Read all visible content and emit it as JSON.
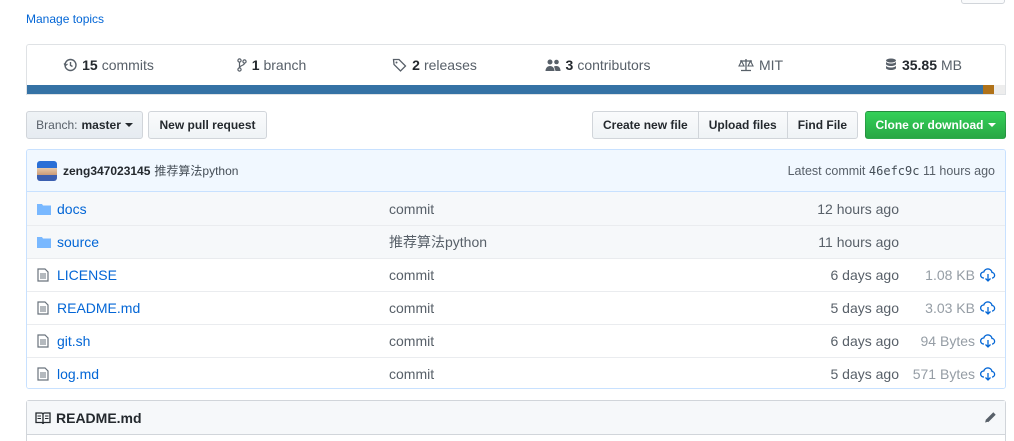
{
  "topics": {
    "manage_label": "Manage topics"
  },
  "summary": {
    "commits": {
      "count": "15",
      "label": "commits",
      "icon": "history-icon"
    },
    "branches": {
      "count": "1",
      "label": "branch",
      "icon": "branch-icon"
    },
    "releases": {
      "count": "2",
      "label": "releases",
      "icon": "tag-icon"
    },
    "contributors": {
      "count": "3",
      "label": "contributors",
      "icon": "people-icon"
    },
    "license": {
      "label": "MIT",
      "icon": "law-icon"
    },
    "size": {
      "count": "35.85",
      "label": "MB",
      "icon": "database-icon"
    },
    "languages": [
      {
        "color": "#3572A5",
        "fraction": 0.977
      },
      {
        "color": "#b07219",
        "fraction": 0.012
      },
      {
        "color": "#ededed",
        "fraction": 0.011
      }
    ]
  },
  "toolbar": {
    "branch_label": "Branch:",
    "branch_value": "master",
    "new_pr": "New pull request",
    "create_file": "Create new file",
    "upload_files": "Upload files",
    "find_file": "Find File",
    "clone": "Clone or download"
  },
  "commit": {
    "author": "zeng347023145",
    "message": "推荐算法python",
    "prefix": "Latest commit",
    "sha": "46efc9c",
    "age": "11 hours ago"
  },
  "files": [
    {
      "type": "dir",
      "name": "docs",
      "message": "commit",
      "age": "12 hours ago",
      "size": ""
    },
    {
      "type": "dir",
      "name": "source",
      "message": "推荐算法python",
      "age": "11 hours ago",
      "size": ""
    },
    {
      "type": "file",
      "name": "LICENSE",
      "message": "commit",
      "age": "6 days ago",
      "size": "1.08 KB"
    },
    {
      "type": "file",
      "name": "README.md",
      "message": "commit",
      "age": "5 days ago",
      "size": "3.03 KB"
    },
    {
      "type": "file",
      "name": "git.sh",
      "message": "commit",
      "age": "6 days ago",
      "size": "94 Bytes"
    },
    {
      "type": "file",
      "name": "log.md",
      "message": "commit",
      "age": "5 days ago",
      "size": "571 Bytes"
    }
  ],
  "readme": {
    "title": "README.md"
  },
  "colors": {
    "link": "#0366d6",
    "clone_green": "#28a745",
    "folder": "#79b8ff"
  }
}
